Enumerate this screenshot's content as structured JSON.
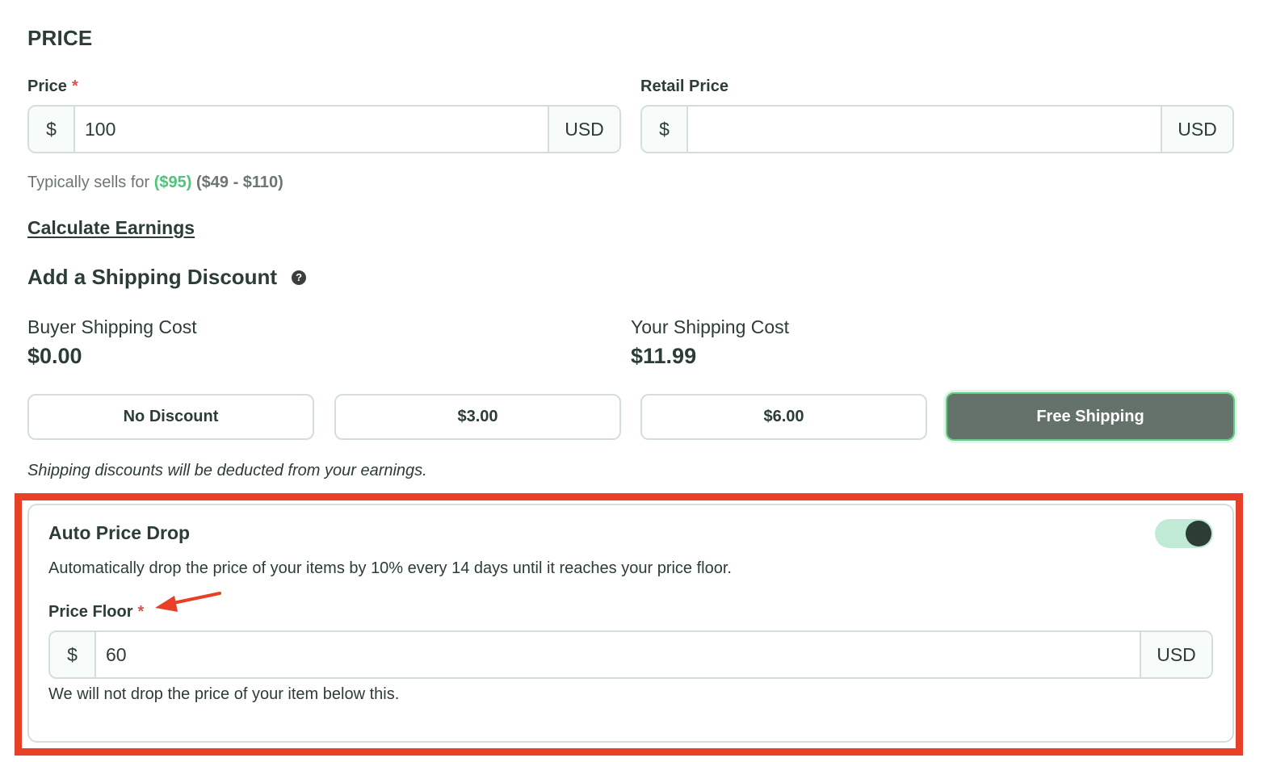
{
  "section_title": "PRICE",
  "price": {
    "label": "Price",
    "required_marker": "*",
    "prefix": "$",
    "value": "100",
    "suffix": "USD"
  },
  "retail_price": {
    "label": "Retail Price",
    "prefix": "$",
    "value": "",
    "suffix": "USD"
  },
  "typical": {
    "prefix": "Typically sells for ",
    "suggested": "($95)",
    "range": "($49 - $110)"
  },
  "calculate_earnings_link": "Calculate Earnings",
  "shipping": {
    "title": "Add a Shipping Discount",
    "help_icon": "?",
    "buyer_cost_label": "Buyer Shipping Cost",
    "buyer_cost_value": "$0.00",
    "your_cost_label": "Your Shipping Cost",
    "your_cost_value": "$11.99",
    "options": [
      {
        "label": "No Discount",
        "selected": false
      },
      {
        "label": "$3.00",
        "selected": false
      },
      {
        "label": "$6.00",
        "selected": false
      },
      {
        "label": "Free Shipping",
        "selected": true
      }
    ],
    "note": "Shipping discounts will be deducted from your earnings."
  },
  "auto_price_drop": {
    "title": "Auto Price Drop",
    "enabled": true,
    "description": "Automatically drop the price of your items by 10% every 14 days until it reaches your price floor.",
    "price_floor": {
      "label": "Price Floor",
      "required_marker": "*",
      "prefix": "$",
      "value": "60",
      "suffix": "USD"
    },
    "note": "We will not drop the price of your item below this."
  },
  "colors": {
    "annotation_red": "#e84026",
    "accent_green": "#4fc37a",
    "selected_button": "#65726a",
    "toggle_track": "#c0ead6",
    "text_dark": "#2c3d35"
  }
}
